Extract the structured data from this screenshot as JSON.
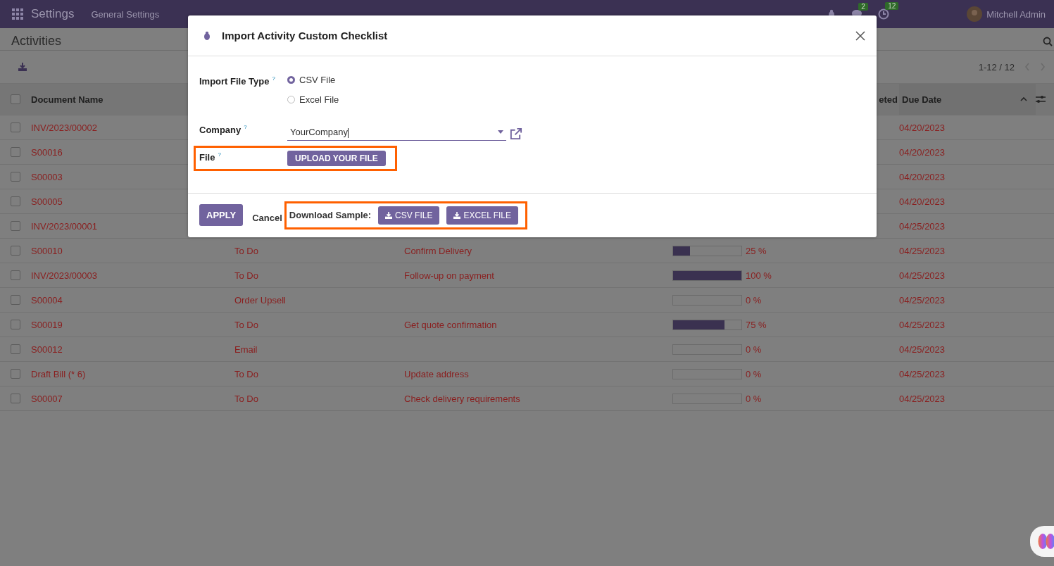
{
  "navbar": {
    "app_name": "Settings",
    "menu": [
      "General Settings"
    ],
    "chat_count": "2",
    "activity_count": "12",
    "user": "Mitchell Admin"
  },
  "control_panel": {
    "title": "Activities",
    "pager": "1-12 / 12"
  },
  "table": {
    "select_all_checked": false,
    "columns": [
      {
        "label": "Document Name",
        "kind": "document"
      },
      {
        "label": "eted",
        "kind": "progress"
      },
      {
        "label": "Due Date",
        "kind": "due",
        "sorted": true
      }
    ],
    "rows": [
      {
        "document": "INV/2023/00002",
        "due_date": "04/20/2023",
        "checked": false
      },
      {
        "document": "S00016",
        "due_date": "04/20/2023",
        "checked": false
      },
      {
        "document": "S00003",
        "due_date": "04/20/2023",
        "checked": false
      },
      {
        "document": "S00005",
        "due_date": "04/20/2023",
        "checked": false
      },
      {
        "document": "INV/2023/00001",
        "due_date": "04/25/2023",
        "checked": false
      },
      {
        "document": "S00010",
        "activity_type": "To Do",
        "summary": "Confirm Delivery",
        "level": 0.25,
        "progress": "25 %",
        "due_date": "04/25/2023",
        "checked": false
      },
      {
        "document": "INV/2023/00003",
        "activity_type": "To Do",
        "summary": "Follow-up on payment",
        "level": 1,
        "progress": "100 %",
        "due_date": "04/25/2023",
        "checked": false
      },
      {
        "document": "S00004",
        "activity_type": "Order Upsell",
        "level": 0,
        "progress": "0 %",
        "due_date": "04/25/2023",
        "checked": false
      },
      {
        "document": "S00019",
        "activity_type": "To Do",
        "summary": "Get quote confirmation",
        "level": 0.75,
        "progress": "75 %",
        "due_date": "04/25/2023",
        "checked": false
      },
      {
        "document": "S00012",
        "activity_type": "Email",
        "level": 0,
        "progress": "0 %",
        "due_date": "04/25/2023",
        "checked": false
      },
      {
        "document": "Draft Bill (* 6)",
        "activity_type": "To Do",
        "summary": "Update address",
        "level": 0,
        "progress": "0 %",
        "due_date": "04/25/2023",
        "checked": false
      },
      {
        "document": "S00007",
        "activity_type": "To Do",
        "summary": "Check delivery requirements",
        "level": 0,
        "progress": "0 %",
        "due_date": "04/25/2023",
        "checked": false
      }
    ]
  },
  "modal": {
    "title": "Import Activity Custom Checklist",
    "fields": [
      {
        "kind": "radio",
        "label": "Import File Type",
        "help": "?",
        "options": [
          {
            "label": "CSV File",
            "selected": true
          },
          {
            "label": "Excel File",
            "selected": false
          }
        ]
      },
      {
        "kind": "select",
        "label": "Company",
        "help": "?",
        "value": "YourCompany"
      },
      {
        "kind": "upload",
        "label": "File",
        "help": "?",
        "button": "UPLOAD YOUR FILE",
        "highlighted": true
      }
    ],
    "footer": {
      "apply": "APPLY",
      "cancel": "Cancel",
      "download": {
        "label": "Download Sample:",
        "buttons": [
          "CSV FILE",
          "EXCEL FILE"
        ],
        "highlighted": true
      }
    }
  }
}
